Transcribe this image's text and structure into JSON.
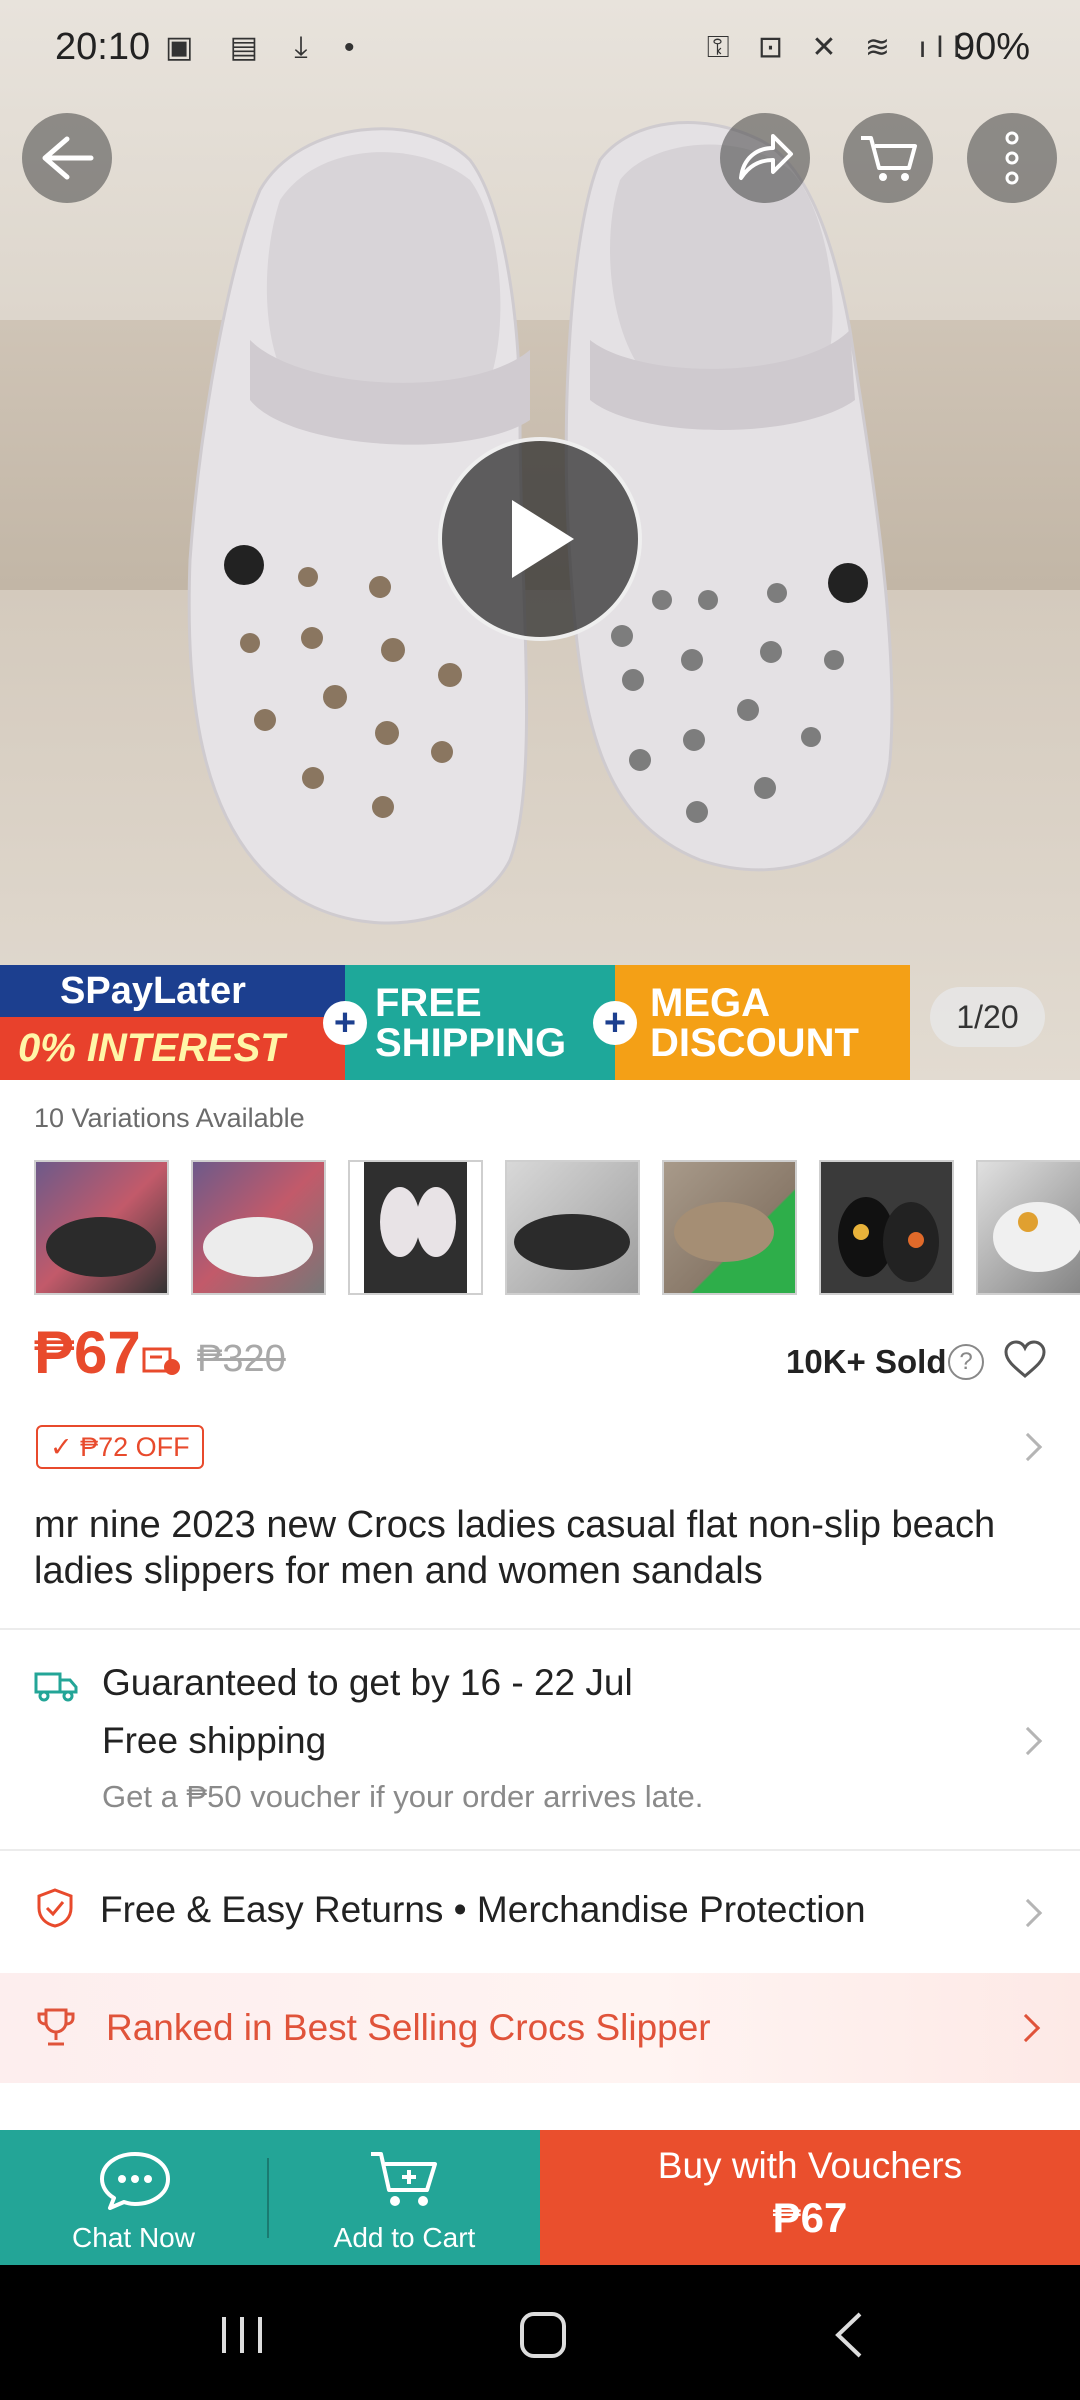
{
  "status_bar": {
    "time": "20:10",
    "battery": "90%",
    "left_icons": "▣ ▤ ⤓ •",
    "right_icons": "⚿ ⊡ ✕ ≋ ıll"
  },
  "hero": {
    "page_indicator": "1/20"
  },
  "banner": {
    "spaylater": "SPayLater",
    "interest": "0% INTEREST",
    "free_shipping_1": "FREE",
    "free_shipping_2": "SHIPPING",
    "mega_1": "MEGA",
    "mega_2": "DISCOUNT"
  },
  "product": {
    "variations_label": "10 Variations Available",
    "price": "₱67",
    "original_price": "₱320",
    "sold": "10K+ Sold",
    "discount_chip": "₱72 OFF",
    "title": "mr nine 2023 new Crocs ladies casual flat non-slip beach ladies slippers for men and women sandals"
  },
  "shipping": {
    "guarantee": "Guaranteed to get by 16 - 22 Jul",
    "free": "Free shipping",
    "voucher_note": "Get a ₱50 voucher if your order arrives late."
  },
  "returns": {
    "text": "Free & Easy Returns  •  Merchandise Protection"
  },
  "ranking": {
    "text": "Ranked in Best Selling Crocs Slipper"
  },
  "bottom_bar": {
    "chat": "Chat Now",
    "add_to_cart": "Add to Cart",
    "buy_line1": "Buy with Vouchers",
    "buy_line2": "₱67"
  },
  "colors": {
    "accent": "#e84a2c",
    "teal": "#23a597",
    "buy": "#ea4f2d"
  }
}
